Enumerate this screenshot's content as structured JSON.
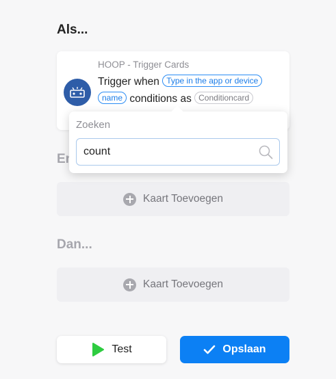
{
  "sections": {
    "if_title": "Als...",
    "and_title": "En",
    "then_title": "Dan..."
  },
  "trigger_card": {
    "source": "HOOP - Trigger Cards",
    "text_before": "Trigger when ",
    "token_device": "Type in the app or device",
    "token_name": "name",
    "text_middle": " conditions as ",
    "token_condition": "Conditioncard",
    "icon": "hoop-app-icon"
  },
  "search_popover": {
    "label": "Zoeken",
    "value": "count",
    "icon": "search-icon"
  },
  "add_card_label": "Kaart Toevoegen",
  "buttons": {
    "test_label": "Test",
    "save_label": "Opslaan"
  },
  "colors": {
    "accent": "#0c80f4",
    "test_play": "#2ecc40",
    "app_icon_bg": "#2e5da8"
  }
}
